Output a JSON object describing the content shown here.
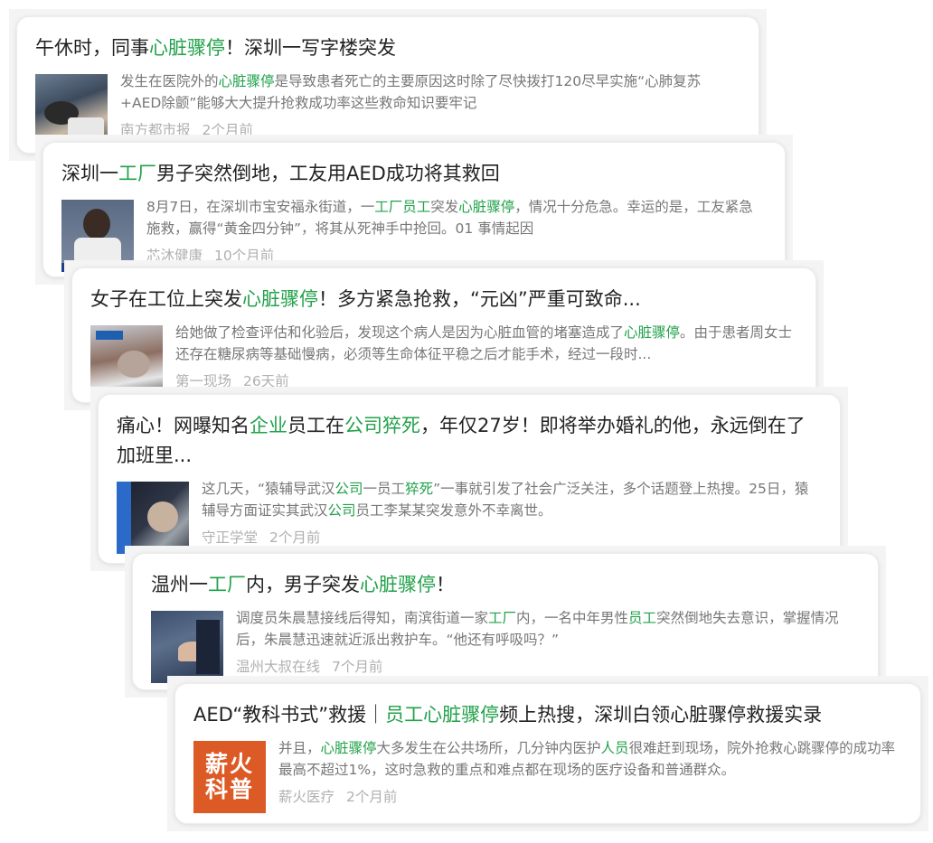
{
  "cards": [
    {
      "title": [
        [
          "午休时，同事",
          false
        ],
        [
          "心脏骤停",
          true
        ],
        [
          "！深圳一写字楼突发",
          false
        ]
      ],
      "snippet": [
        [
          "发生在医院外的",
          false
        ],
        [
          "心脏骤停",
          true
        ],
        [
          "是导致患者死亡的主要原因这时除了尽快拨打120尽早实施“心肺复苏+AED除颤”能够大大提升抢救成功率这些救命知识要牢记",
          false
        ]
      ],
      "source": "南方都市报",
      "time": "2个月前",
      "thumb": "cpr-scene-thumbnail"
    },
    {
      "title": [
        [
          "深圳一",
          false
        ],
        [
          "工厂",
          true
        ],
        [
          "男子突然倒地，工友用AED成功将其救回",
          false
        ]
      ],
      "snippet": [
        [
          "8月7日，在深圳市宝安福永街道，一",
          false
        ],
        [
          "工厂员工",
          true
        ],
        [
          "突发",
          false
        ],
        [
          "心脏骤停",
          true
        ],
        [
          "，情况十分危急。幸运的是，工友紧急施救，赢得“黄金四分钟”，将其从死神手中抢回。01 事情起因",
          false
        ]
      ],
      "source": "芯沐健康",
      "time": "10个月前",
      "thumb": "interview-thumbnail"
    },
    {
      "title": [
        [
          "女子在工位上突发",
          false
        ],
        [
          "心脏骤停",
          true
        ],
        [
          "！多方紧急抢救，“元凶”严重可致命...",
          false
        ]
      ],
      "snippet": [
        [
          "给她做了检查评估和化验后，发现这个病人是因为心脏血管的堵塞造成了",
          false
        ],
        [
          "心脏骤停",
          true
        ],
        [
          "。由于患者周女士还存在糖尿病等基础慢病，必须等生命体征平稳之后才能手术，经过一段时...",
          false
        ]
      ],
      "source": "第一现场",
      "time": "26天前",
      "thumb": "rescue-news-thumbnail"
    },
    {
      "title": [
        [
          "痛心！网曝知名",
          false
        ],
        [
          "企业",
          true
        ],
        [
          "员工在",
          false
        ],
        [
          "公司猝死",
          true
        ],
        [
          "，年仅27岁！即将举办婚礼的他，永远倒在了加班里...",
          false
        ]
      ],
      "snippet": [
        [
          "这几天，“猿辅导武汉",
          false
        ],
        [
          "公司",
          true
        ],
        [
          "一员工",
          false
        ],
        [
          "猝死",
          true
        ],
        [
          "”一事就引发了社会广泛关注，多个话题登上热搜。25日，猿辅导方面证实其武汉",
          false
        ],
        [
          "公司",
          true
        ],
        [
          "员工李某某突发意外不幸离世。",
          false
        ]
      ],
      "source": "守正学堂",
      "time": "2个月前",
      "thumb": "stressed-worker-thumbnail"
    },
    {
      "title": [
        [
          "温州一",
          false
        ],
        [
          "工厂",
          true
        ],
        [
          "内，男子突发",
          false
        ],
        [
          "心脏骤停",
          true
        ],
        [
          "！",
          false
        ]
      ],
      "snippet": [
        [
          "调度员朱晨慧接线后得知，南滨街道一家",
          false
        ],
        [
          "工厂",
          true
        ],
        [
          "内，一名中年男性",
          false
        ],
        [
          "员工",
          true
        ],
        [
          "突然倒地失去意识，掌握情况后，朱晨慧迅速就近派出救护车。“他还有呼吸吗？”",
          false
        ]
      ],
      "source": "温州大叔在线",
      "time": "7个月前",
      "thumb": "cpr-hands-thumbnail"
    },
    {
      "title": [
        [
          "AED“教科书式”救援｜",
          false
        ],
        [
          "员工心脏骤停",
          true
        ],
        [
          "频上热搜，深圳白领心脏骤停救援实录",
          false
        ]
      ],
      "snippet": [
        [
          "并且，",
          false
        ],
        [
          "心脏骤停",
          true
        ],
        [
          "大多发生在公共场所，几分钟内医护",
          false
        ],
        [
          "人员",
          true
        ],
        [
          "很难赶到现场，院外抢救心跳骤停的成功率最高不超过1%，这时急救的重点和难点都在现场的医疗设备和普通群众。",
          false
        ]
      ],
      "source": "薪火医疗",
      "time": "2个月前",
      "thumb": "xinhuo-logo-thumbnail",
      "thumb_text": [
        "薪火",
        "科普"
      ]
    }
  ]
}
